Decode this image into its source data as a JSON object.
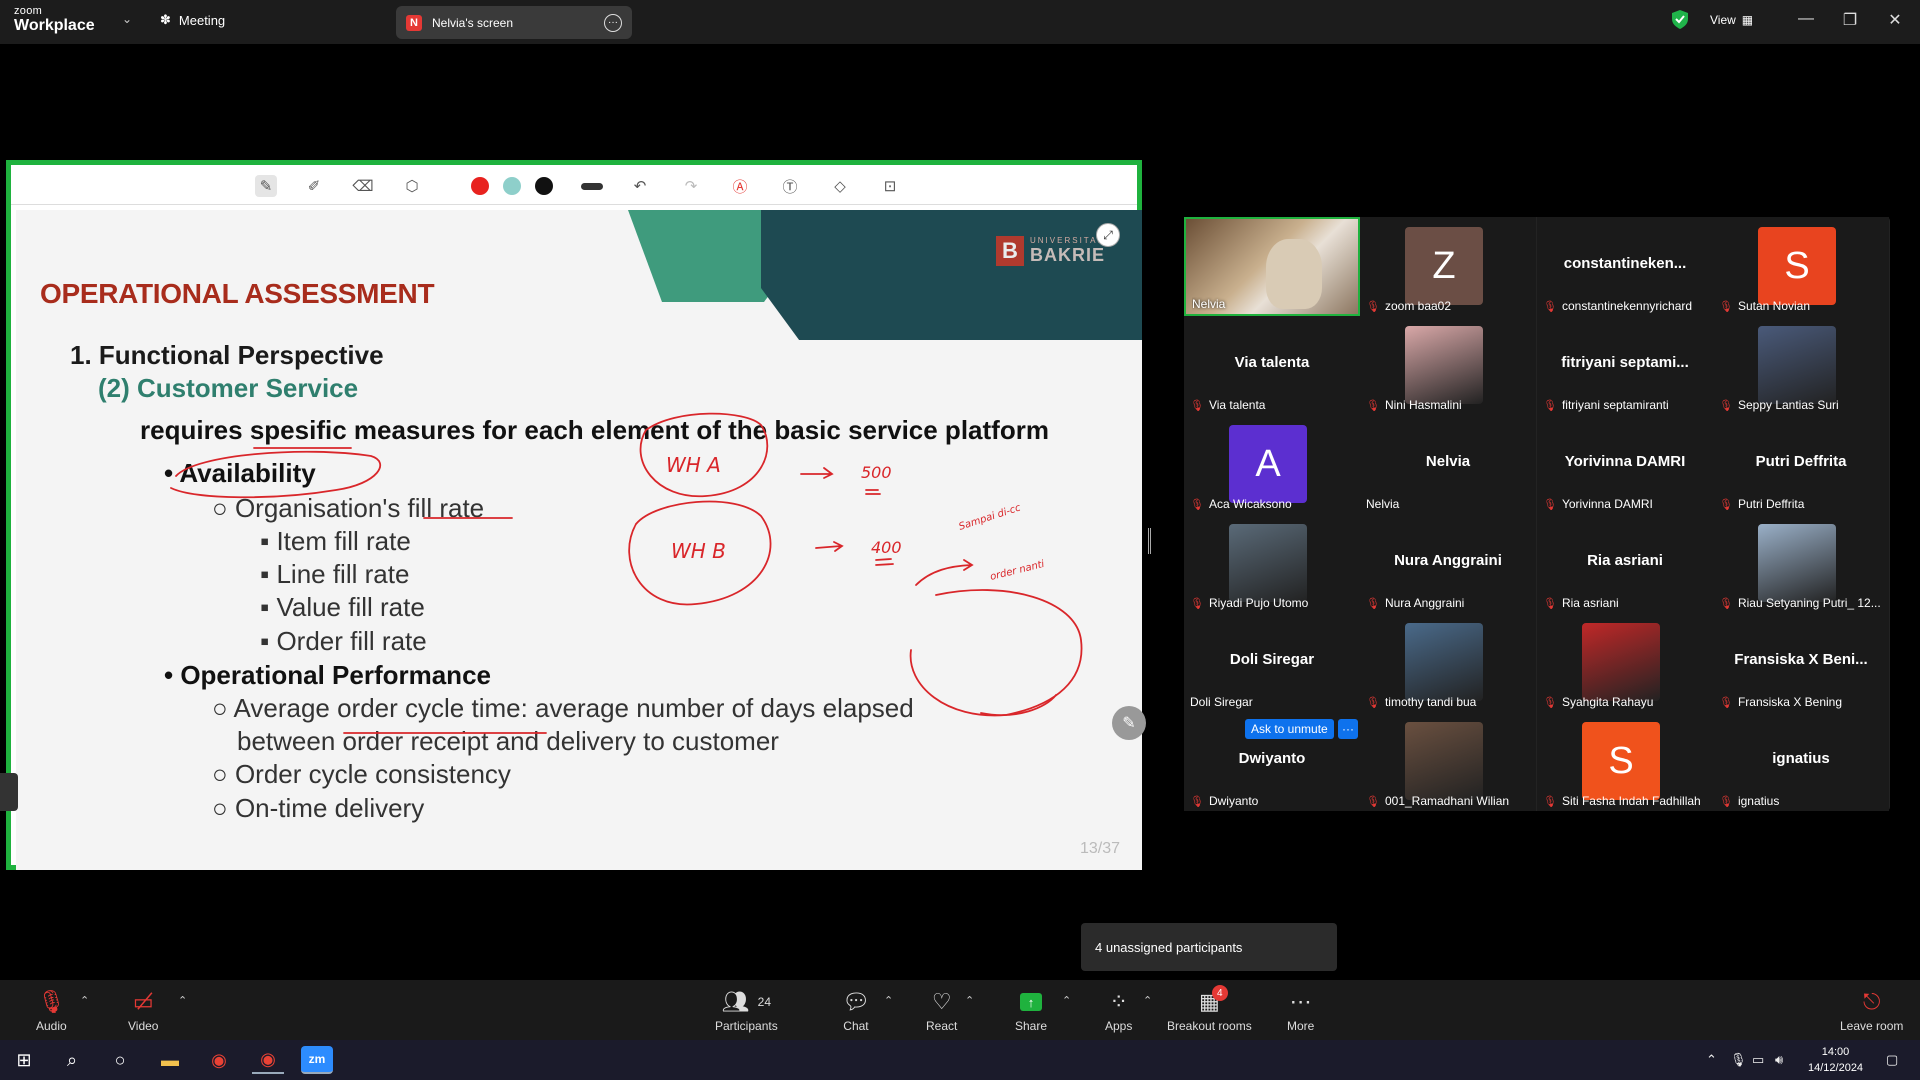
{
  "app": {
    "brand_small": "zoom",
    "brand_big": "Workplace",
    "meeting_label": "Meeting",
    "screen_tab_initial": "N",
    "screen_tab_label": "Nelvia's screen",
    "view_label": "View"
  },
  "slide": {
    "title": "OPERATIONAL ASSESSMENT",
    "h1": "1. Functional Perspective",
    "h2": "(2) Customer Service",
    "requirement": "requires spesific measures for each element of the basic service platform",
    "bullet1": "Availability",
    "b1_sub": "Organisation's fill rate",
    "b1_subsub": [
      "Item fill rate",
      "Line fill rate",
      "Value fill rate",
      "Order fill rate"
    ],
    "bullet2": "Operational Performance",
    "b2_sub1_line1": "Average order cycle time: average number of days elapsed",
    "b2_sub1_line2": "between order receipt and delivery to customer",
    "b2_sub2": "Order cycle consistency",
    "b2_sub3": "On-time delivery",
    "page": "13/37",
    "logo_small": "UNIVERSITAS",
    "logo_big": "BAKRIE",
    "logo_mark": "B"
  },
  "annotations": {
    "wh_a": "WH A",
    "wh_b": "WH B",
    "n500": "500",
    "n400": "400",
    "note1": "Sampai di-cc",
    "note2": "order nanti"
  },
  "toolbar_colors": {
    "red": "#e8221f",
    "teal": "#8ecfca",
    "black": "#111111"
  },
  "gallery": [
    {
      "display": "video",
      "name": "Nelvia",
      "avatar_color": "#8a6a4a",
      "muted": false,
      "active": true
    },
    {
      "display": "avatar",
      "letter": "Z",
      "avatar_color": "#6b4e45",
      "name": "zoom baa02",
      "muted": true
    },
    {
      "display": "text",
      "big": "constantineken...",
      "name": "constantinekennyrichard",
      "muted": true
    },
    {
      "display": "avatar",
      "letter": "S",
      "avatar_color": "#e8441f",
      "name": "Sutan Novian",
      "muted": true
    },
    {
      "display": "text",
      "big": "Via talenta",
      "name": "Via talenta",
      "muted": true
    },
    {
      "display": "photo",
      "avatar_color": "#d9a8a8",
      "name": "Nini Hasmalini",
      "muted": true
    },
    {
      "display": "text",
      "big": "fitriyani  septami...",
      "name": "fitriyani septamiranti",
      "muted": true
    },
    {
      "display": "photo",
      "avatar_color": "#4a5a7a",
      "name": "Seppy Lantias Suri",
      "muted": true
    },
    {
      "display": "avatar",
      "letter": "A",
      "avatar_color": "#5c2fd0",
      "name": "Aca Wicaksono",
      "muted": true
    },
    {
      "display": "text",
      "big": "Nelvia",
      "name": "Nelvia",
      "muted": false
    },
    {
      "display": "text",
      "big": "Yorivinna DAMRI",
      "name": "Yorivinna DAMRI",
      "muted": true
    },
    {
      "display": "text",
      "big": "Putri Deffrita",
      "name": "Putri Deffrita",
      "muted": true
    },
    {
      "display": "photo",
      "avatar_color": "#5a6a78",
      "name": "Riyadi Pujo Utomo",
      "muted": true
    },
    {
      "display": "text",
      "big": "Nura Anggraini",
      "name": "Nura Anggraini",
      "muted": true
    },
    {
      "display": "text",
      "big": "Ria asriani",
      "name": "Ria asriani",
      "muted": true
    },
    {
      "display": "photo",
      "avatar_color": "#9ab0c8",
      "name": "Riau Setyaning Putri_ 12...",
      "muted": true
    },
    {
      "display": "text",
      "big": "Doli Siregar",
      "name": "Doli Siregar",
      "muted": false
    },
    {
      "display": "photo",
      "avatar_color": "#4a6a8a",
      "name": "timothy tandi bua",
      "muted": true
    },
    {
      "display": "photo",
      "avatar_color": "#c02828",
      "name": "Syahgita Rahayu",
      "muted": true
    },
    {
      "display": "text",
      "big": "Fransiska X Beni...",
      "name": "Fransiska X Bening",
      "muted": true
    },
    {
      "display": "text",
      "big": "Dwiyanto",
      "name": "Dwiyanto",
      "muted": true
    },
    {
      "display": "photo",
      "avatar_color": "#6a5040",
      "name": "001_Ramadhani Wilian",
      "muted": true
    },
    {
      "display": "avatar",
      "letter": "S",
      "avatar_color": "#f0521c",
      "name": "Siti Fasha Indah Fadhillah",
      "muted": true
    },
    {
      "display": "text",
      "big": "ignatius",
      "name": "ignatius",
      "muted": true
    }
  ],
  "ask_to_unmute": "Ask to unmute",
  "unmute_more": "···",
  "tooltip": "4 unassigned participants",
  "controls": {
    "audio": "Audio",
    "video": "Video",
    "participants": "Participants",
    "participants_count": "24",
    "chat": "Chat",
    "react": "React",
    "share": "Share",
    "apps": "Apps",
    "breakout": "Breakout rooms",
    "breakout_badge": "4",
    "more": "More",
    "leave": "Leave room"
  },
  "clock": {
    "time": "14:00",
    "date": "14/12/2024"
  }
}
